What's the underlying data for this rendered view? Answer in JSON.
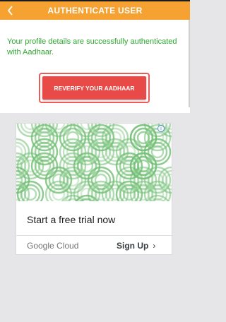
{
  "header": {
    "title": "AUTHENTICATE USER",
    "back_icon": "chevron-left-icon"
  },
  "status": {
    "message": "Your profile details are successfully authenticated with Aadhaar."
  },
  "actions": {
    "reverify_label": "REVERIFY YOUR AADHAAR"
  },
  "ad": {
    "headline": "Start a free trial now",
    "advertiser": "Google Cloud",
    "cta_label": "Sign Up",
    "cta_icon": "chevron-right-icon",
    "info_icon": "info-icon",
    "more_icon": "more-vert-icon"
  },
  "colors": {
    "appbar": "#f6a232",
    "success_text": "#2fa832",
    "reverify_button": "#e84a47",
    "ad_pattern": "#4caf50"
  }
}
